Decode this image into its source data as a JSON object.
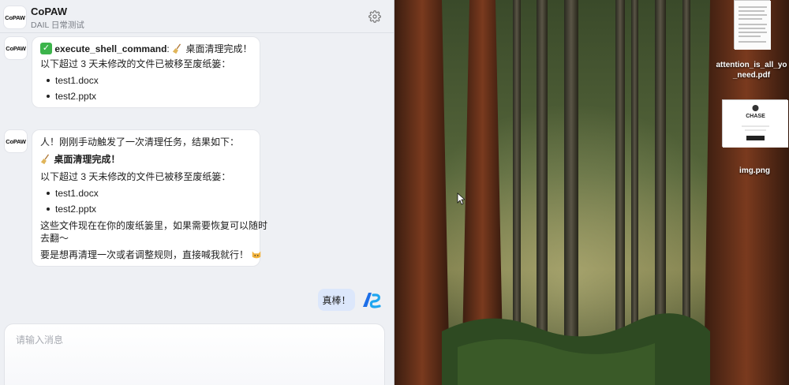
{
  "header": {
    "logo_text": "CoPAW",
    "title": "CoPAW",
    "subtitle": "DAIL 日常测试"
  },
  "messages": [
    {
      "avatar_text": "CoPAW",
      "tool_name": "execute_shell_command",
      "tool_sep": ":",
      "tool_result": "桌面清理完成！",
      "line": "以下超过 3 天未修改的文件已被移至废纸篓：",
      "files": [
        "test1.docx",
        "test2.pptx"
      ]
    },
    {
      "avatar_text": "CoPAW",
      "intro": "人！刚刚手动触发了一次清理任务，结果如下：",
      "heading": "桌面清理完成！",
      "line": "以下超过 3 天未修改的文件已被移至废纸篓：",
      "files": [
        "test1.docx",
        "test2.pptx"
      ],
      "note_line1": "这些文件现在在你的废纸篓里，如果需要恢复可以随时",
      "note_line2": "去翻～",
      "closing": "要是想再清理一次或者调整规则，直接喊我就行！"
    }
  ],
  "user_message": "真棒！",
  "input": {
    "placeholder": "请输入消息"
  },
  "desktop": {
    "files": [
      {
        "label_line1": "attention_is_all_yo",
        "label_line2": "_need.pdf",
        "icon": "pdf-thumbnail"
      },
      {
        "label_line1": "img.png",
        "icon": "png-thumbnail",
        "thumb_title": "CHASE"
      }
    ]
  },
  "colors": {
    "accent": "#3b82f6",
    "user_bubble": "#dce7fb",
    "check_green": "#3cb44b"
  }
}
